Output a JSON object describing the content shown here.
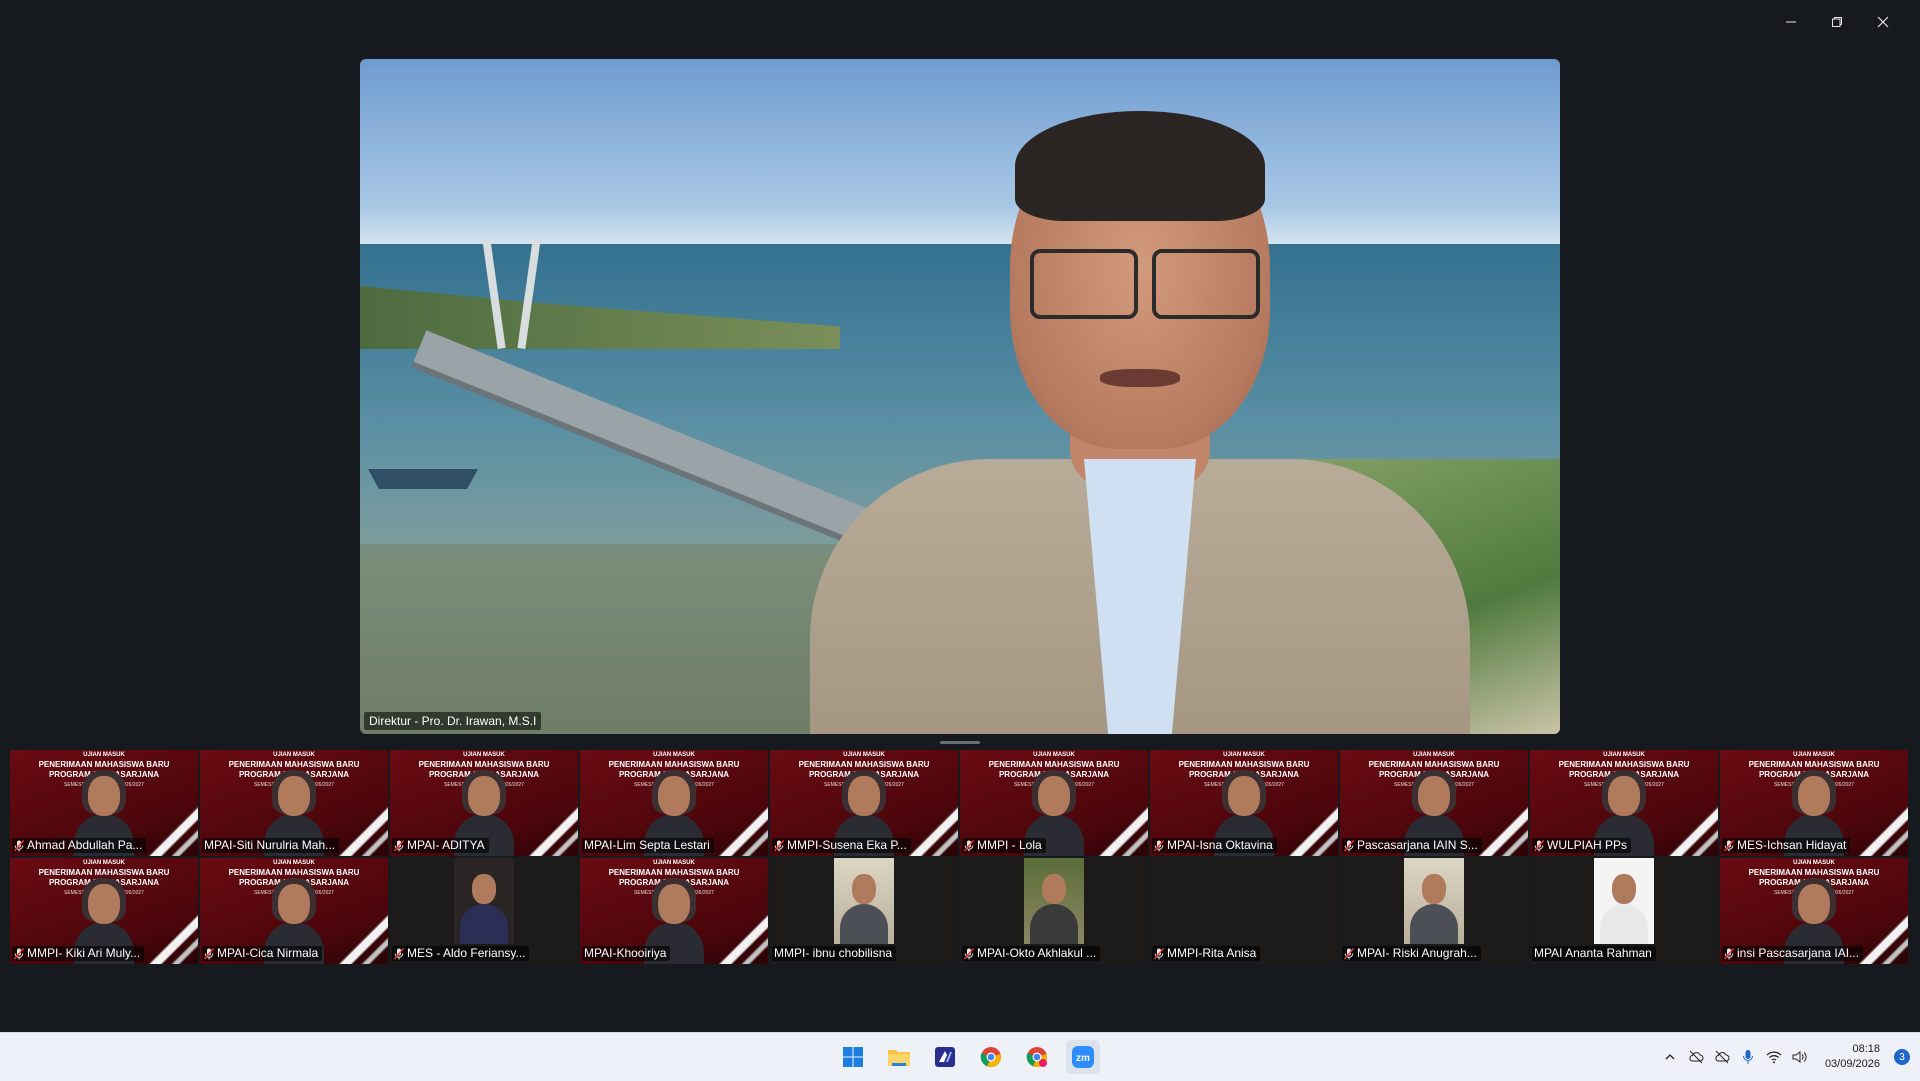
{
  "window": {
    "minimize_icon": "minimize-icon",
    "restore_icon": "restore-icon",
    "close_icon": "close-icon"
  },
  "speaker": {
    "name": "Direktur - Pro. Dr. Irawan, M.S.I"
  },
  "banner": {
    "line1": "UJIAN MASUK",
    "line2": "PENERIMAAN MAHASISWA BARU",
    "line3": "PROGRAM PASCASARJANA",
    "line4": "SEMESTER GANJIL TA. 2026/2027"
  },
  "gallery": {
    "row1": [
      {
        "name": "Ahmad Abdullah Pa...",
        "muted": true
      },
      {
        "name": "MPAI-Siti Nurulria Mah...",
        "muted": false
      },
      {
        "name": "MPAI- ADITYA",
        "muted": true
      },
      {
        "name": "MPAI-Lim Septa Lestari",
        "muted": false
      },
      {
        "name": "MMPI-Susena Eka P...",
        "muted": true
      },
      {
        "name": "MMPI - Lola",
        "muted": true
      },
      {
        "name": "MPAI-Isna Oktavina",
        "muted": true
      },
      {
        "name": "Pascasarjana IAIN S...",
        "muted": true
      },
      {
        "name": "WULPIAH PPs",
        "muted": true
      },
      {
        "name": "MES-Ichsan Hidayat",
        "muted": true
      }
    ],
    "row2": [
      {
        "name": "MMPI- Kiki Ari Muly...",
        "muted": true
      },
      {
        "name": "MPAI-Cica Nirmala",
        "muted": true
      },
      {
        "name": "MES - Aldo Feriansy...",
        "muted": true
      },
      {
        "name": "MPAI-Khooiriya",
        "muted": false
      },
      {
        "name": "MMPI- ibnu chobilisna",
        "muted": false
      },
      {
        "name": "MPAI-Okto Akhlakul ...",
        "muted": true
      },
      {
        "name": "MMPI-Rita Anisa",
        "muted": true
      },
      {
        "name": "MPAI- Riski Anugrah...",
        "muted": true
      },
      {
        "name": "MPAI Ananta Rahman",
        "muted": false
      },
      {
        "name": "insi Pascasarjana IAI...",
        "muted": true
      }
    ]
  },
  "taskbar": {
    "apps": [
      "windows-start",
      "file-explorer",
      "vscode-like",
      "chrome",
      "chrome-profile",
      "zoom"
    ],
    "time": "08:18",
    "date": "03/09/2026",
    "notifications": "3"
  }
}
